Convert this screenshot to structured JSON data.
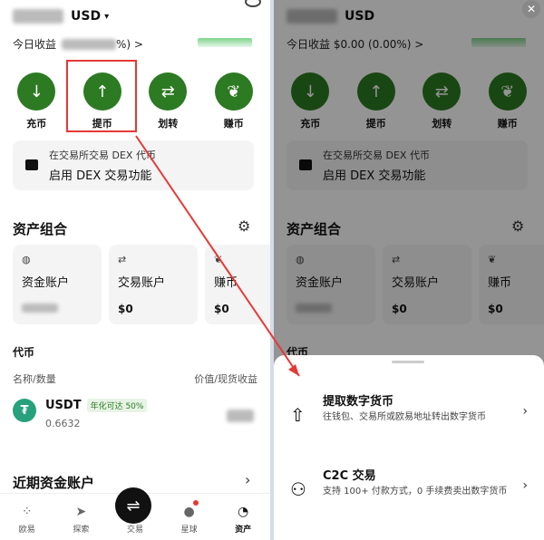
{
  "left": {
    "currency": "USD",
    "today_label": "今日收益",
    "today_value_suffix": "%) >",
    "actions": [
      {
        "label": "充币",
        "icon": "deposit-icon"
      },
      {
        "label": "提币",
        "icon": "withdraw-icon"
      },
      {
        "label": "划转",
        "icon": "transfer-icon"
      },
      {
        "label": "赚币",
        "icon": "earn-icon"
      }
    ],
    "dex": {
      "line1": "在交易所交易 DEX 代币",
      "line2": "启用 DEX 交易功能"
    },
    "portfolio_title": "资产组合",
    "cards": [
      {
        "name": "资金账户",
        "value": ""
      },
      {
        "name": "交易账户",
        "value": "$0"
      },
      {
        "name": "赚币",
        "value": "$0"
      }
    ],
    "tokens_title": "代币",
    "col_name": "名称/数量",
    "col_value": "价值/现货收益",
    "token": {
      "symbol": "USDT",
      "badge": "年化可达 50%",
      "amount": "0.6632"
    },
    "recent_title": "近期资金账户",
    "tabs": [
      {
        "label": "欧易",
        "icon": "okx-icon"
      },
      {
        "label": "探索",
        "icon": "explore-icon"
      },
      {
        "label": "交易",
        "icon": "trade-icon"
      },
      {
        "label": "星球",
        "icon": "planet-icon"
      },
      {
        "label": "资产",
        "icon": "assets-icon"
      }
    ]
  },
  "right": {
    "currency": "USD",
    "today_label": "今日收益 $0.00 (0.00%) >",
    "actions": [
      "充币",
      "提币",
      "划转",
      "赚币"
    ],
    "dex": {
      "line1": "在交易所交易 DEX 代币",
      "line2": "启用 DEX 交易功能"
    },
    "portfolio_title": "资产组合",
    "cards": [
      {
        "name": "资金账户",
        "value": ""
      },
      {
        "name": "交易账户",
        "value": "$0"
      },
      {
        "name": "赚币",
        "value": "$0"
      }
    ],
    "tokens_title": "代币",
    "sheet": [
      {
        "title": "提取数字货币",
        "desc": "往钱包、交易所或欧易地址转出数字货币",
        "icon": "withdraw-icon"
      },
      {
        "title": "C2C 交易",
        "desc": "支持 100+ 付款方式，0 手续费卖出数字货币",
        "icon": "c2c-icon"
      }
    ]
  },
  "colors": {
    "accent": "#2c7a22",
    "highlight": "#e53935"
  }
}
